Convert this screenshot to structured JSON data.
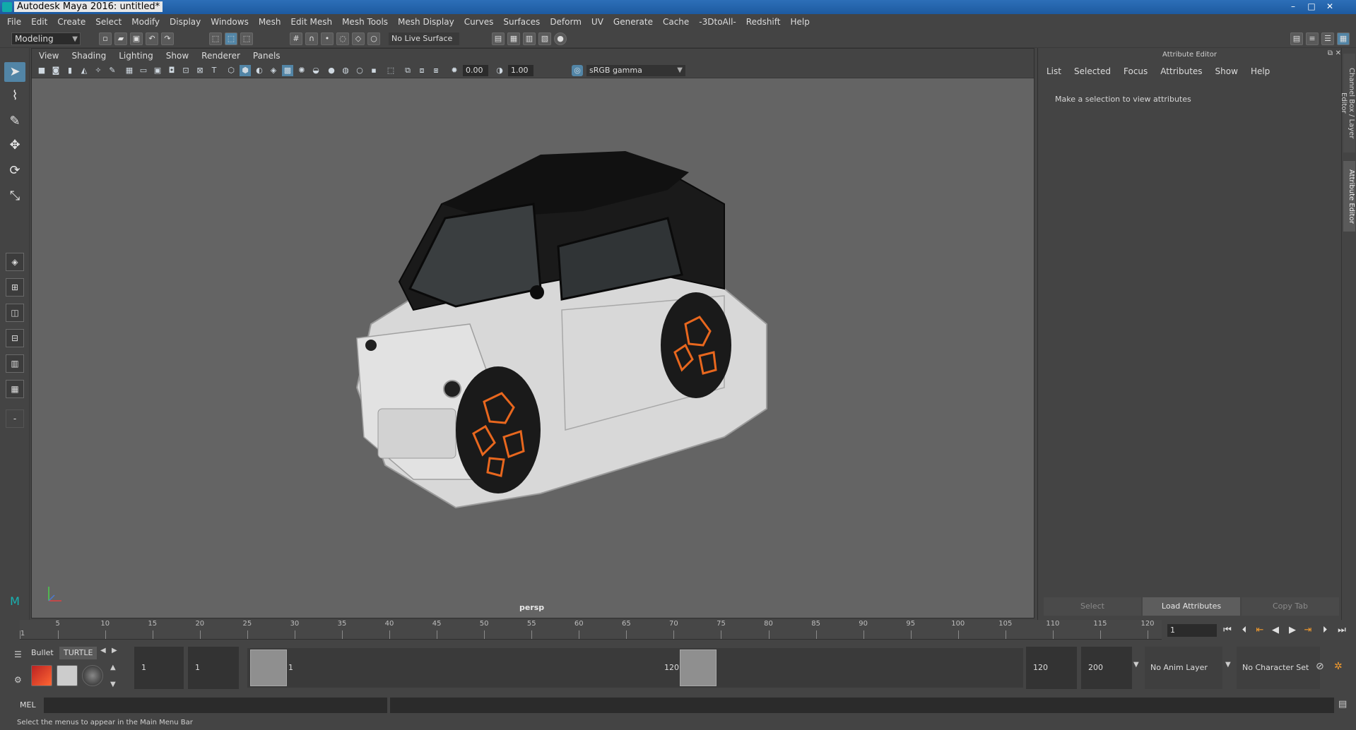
{
  "window": {
    "title": "Autodesk Maya 2016: untitled*"
  },
  "menubar": [
    "File",
    "Edit",
    "Create",
    "Select",
    "Modify",
    "Display",
    "Windows",
    "Mesh",
    "Edit Mesh",
    "Mesh Tools",
    "Mesh Display",
    "Curves",
    "Surfaces",
    "Deform",
    "UV",
    "Generate",
    "Cache",
    "-3DtoAll-",
    "Redshift",
    "Help"
  ],
  "statusline": {
    "mode": "Modeling",
    "live_surface": "No Live Surface"
  },
  "viewport": {
    "menu": [
      "View",
      "Shading",
      "Lighting",
      "Show",
      "Renderer",
      "Panels"
    ],
    "exposure": "0.00",
    "gamma_value": "1.00",
    "color_space": "sRGB gamma",
    "camera_label": "persp"
  },
  "attribute_editor": {
    "title": "Attribute Editor",
    "menu": [
      "List",
      "Selected",
      "Focus",
      "Attributes",
      "Show",
      "Help"
    ],
    "message": "Make a selection to view attributes",
    "buttons": {
      "select": "Select",
      "load": "Load Attributes",
      "copy": "Copy Tab"
    }
  },
  "side_tabs": {
    "channel_box": "Channel Box / Layer Editor",
    "attribute_editor": "Attribute Editor"
  },
  "timeline": {
    "ticks": [
      "1",
      "5",
      "10",
      "15",
      "20",
      "25",
      "30",
      "35",
      "40",
      "45",
      "50",
      "55",
      "60",
      "65",
      "70",
      "75",
      "80",
      "85",
      "90",
      "95",
      "100",
      "105",
      "110",
      "115",
      "120"
    ],
    "current_frame": "1"
  },
  "shelf": {
    "tabs": [
      "Bullet",
      "TURTLE"
    ]
  },
  "range": {
    "start": "1",
    "playback_start": "1",
    "inner_start": "1",
    "inner_end": "120",
    "playback_end": "120",
    "end": "200",
    "anim_layer": "No Anim Layer",
    "character_set": "No Character Set"
  },
  "command": {
    "lang": "MEL"
  },
  "help_line": "Select the menus to appear in the Main Menu Bar",
  "colors": {
    "accent": "#5285a6",
    "viewport_bg": "#646464",
    "panel_bg": "#444444",
    "wheel_accent": "#e8671e"
  }
}
